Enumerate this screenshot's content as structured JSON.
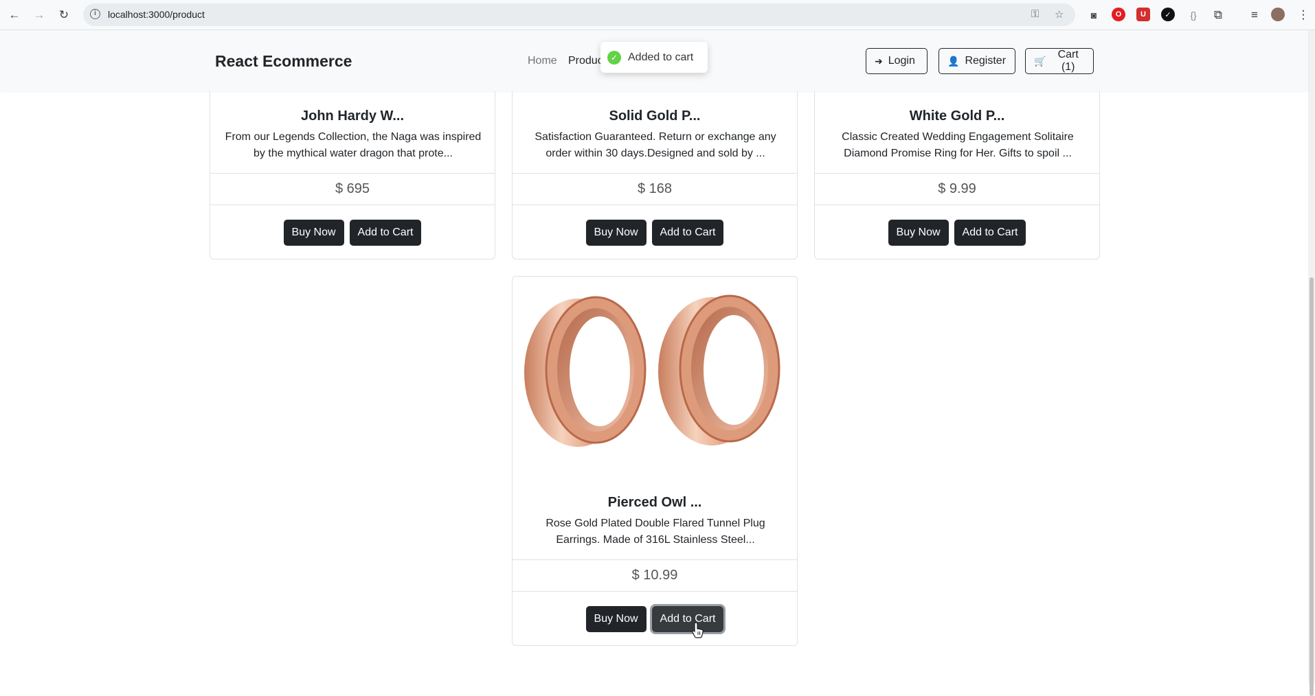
{
  "browser": {
    "url": "localhost:3000/product",
    "ext_badges": [
      "O",
      "U",
      "✓"
    ]
  },
  "navbar": {
    "brand": "React Ecommerce",
    "links": [
      "Home",
      "Produc"
    ],
    "login_label": "Login",
    "register_label": "Register",
    "cart_label": "Cart (1)"
  },
  "toast": {
    "message": "Added to cart",
    "icon": "check-circle-icon"
  },
  "products": [
    {
      "title": "John Hardy W...",
      "desc": "From our Legends Collection, the Naga was inspired by the mythical water dragon that prote...",
      "price": "$ 695",
      "buy_label": "Buy Now",
      "cart_label": "Add to Cart"
    },
    {
      "title": "Solid Gold P...",
      "desc": "Satisfaction Guaranteed. Return or exchange any order within 30 days.Designed and sold by ...",
      "price": "$ 168",
      "buy_label": "Buy Now",
      "cart_label": "Add to Cart"
    },
    {
      "title": "White Gold P...",
      "desc": "Classic Created Wedding Engagement Solitaire Diamond Promise Ring for Her. Gifts to spoil ...",
      "price": "$ 9.99",
      "buy_label": "Buy Now",
      "cart_label": "Add to Cart"
    },
    {
      "title": "Pierced Owl ...",
      "desc": "Rose Gold Plated Double Flared Tunnel Plug Earrings. Made of 316L Stainless Steel...",
      "price": "$ 10.99",
      "buy_label": "Buy Now",
      "cart_label": "Add to Cart"
    }
  ],
  "colors": {
    "dark_button": "#212529",
    "toast_success": "#61d345",
    "rose_gold": "#e8a788"
  }
}
